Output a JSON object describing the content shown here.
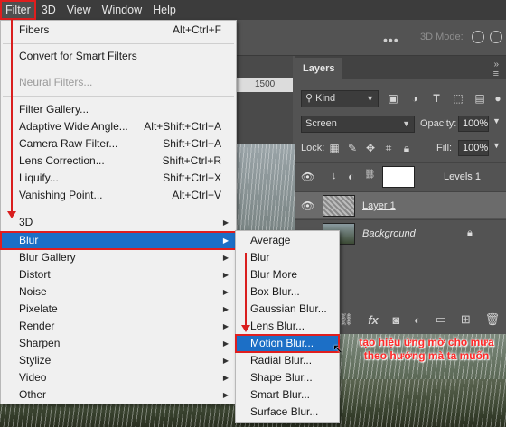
{
  "menubar": {
    "items": [
      "Filter",
      "3D",
      "View",
      "Window",
      "Help"
    ]
  },
  "options_bar": {
    "dots": "•••",
    "mode_label": "3D Mode:"
  },
  "document": {
    "ruler_value": "1500"
  },
  "filter_menu": {
    "items": [
      {
        "label": "Fibers",
        "shortcut": "Alt+Ctrl+F"
      },
      {
        "label": "Convert for Smart Filters",
        "shortcut": ""
      },
      {
        "label": "Neural Filters...",
        "shortcut": "",
        "disabled": true
      },
      {
        "label": "Filter Gallery...",
        "shortcut": ""
      },
      {
        "label": "Adaptive Wide Angle...",
        "shortcut": "Alt+Shift+Ctrl+A"
      },
      {
        "label": "Camera Raw Filter...",
        "shortcut": "Shift+Ctrl+A"
      },
      {
        "label": "Lens Correction...",
        "shortcut": "Shift+Ctrl+R"
      },
      {
        "label": "Liquify...",
        "shortcut": "Shift+Ctrl+X"
      },
      {
        "label": "Vanishing Point...",
        "shortcut": "Alt+Ctrl+V"
      },
      {
        "label": "3D",
        "submenu": true
      },
      {
        "label": "Blur",
        "submenu": true,
        "highlighted": true
      },
      {
        "label": "Blur Gallery",
        "submenu": true
      },
      {
        "label": "Distort",
        "submenu": true
      },
      {
        "label": "Noise",
        "submenu": true
      },
      {
        "label": "Pixelate",
        "submenu": true
      },
      {
        "label": "Render",
        "submenu": true
      },
      {
        "label": "Sharpen",
        "submenu": true
      },
      {
        "label": "Stylize",
        "submenu": true
      },
      {
        "label": "Video",
        "submenu": true
      },
      {
        "label": "Other",
        "submenu": true
      }
    ]
  },
  "blur_submenu": {
    "items": [
      {
        "label": "Average"
      },
      {
        "label": "Blur"
      },
      {
        "label": "Blur More"
      },
      {
        "label": "Box Blur..."
      },
      {
        "label": "Gaussian Blur..."
      },
      {
        "label": "Lens Blur..."
      },
      {
        "label": "Motion Blur...",
        "highlighted": true
      },
      {
        "label": "Radial Blur..."
      },
      {
        "label": "Shape Blur..."
      },
      {
        "label": "Smart Blur..."
      },
      {
        "label": "Surface Blur..."
      }
    ]
  },
  "layers_panel": {
    "tab": "Layers",
    "kind_filter": "Kind",
    "blend_mode": "Screen",
    "opacity_label": "Opacity:",
    "opacity_value": "100%",
    "lock_label": "Lock:",
    "fill_label": "Fill:",
    "fill_value": "100%",
    "layers": [
      {
        "name": "Levels 1",
        "type": "adjustment"
      },
      {
        "name": "Layer 1",
        "selected": true
      },
      {
        "name": "Background",
        "locked": true
      }
    ],
    "footer_icons": [
      "link-icon",
      "fx-icon",
      "mask-icon",
      "adjustment-icon",
      "folder-icon",
      "new-layer-icon",
      "trash-icon"
    ]
  },
  "annotation": {
    "line1": "tạo hiệu ứng mờ cho mưa",
    "line2": "theo hướng mà ta muốn"
  },
  "colors": {
    "highlight": "#1c6fc6",
    "guide_red": "#d91e1e",
    "annotation_red": "#ff2a2a"
  }
}
